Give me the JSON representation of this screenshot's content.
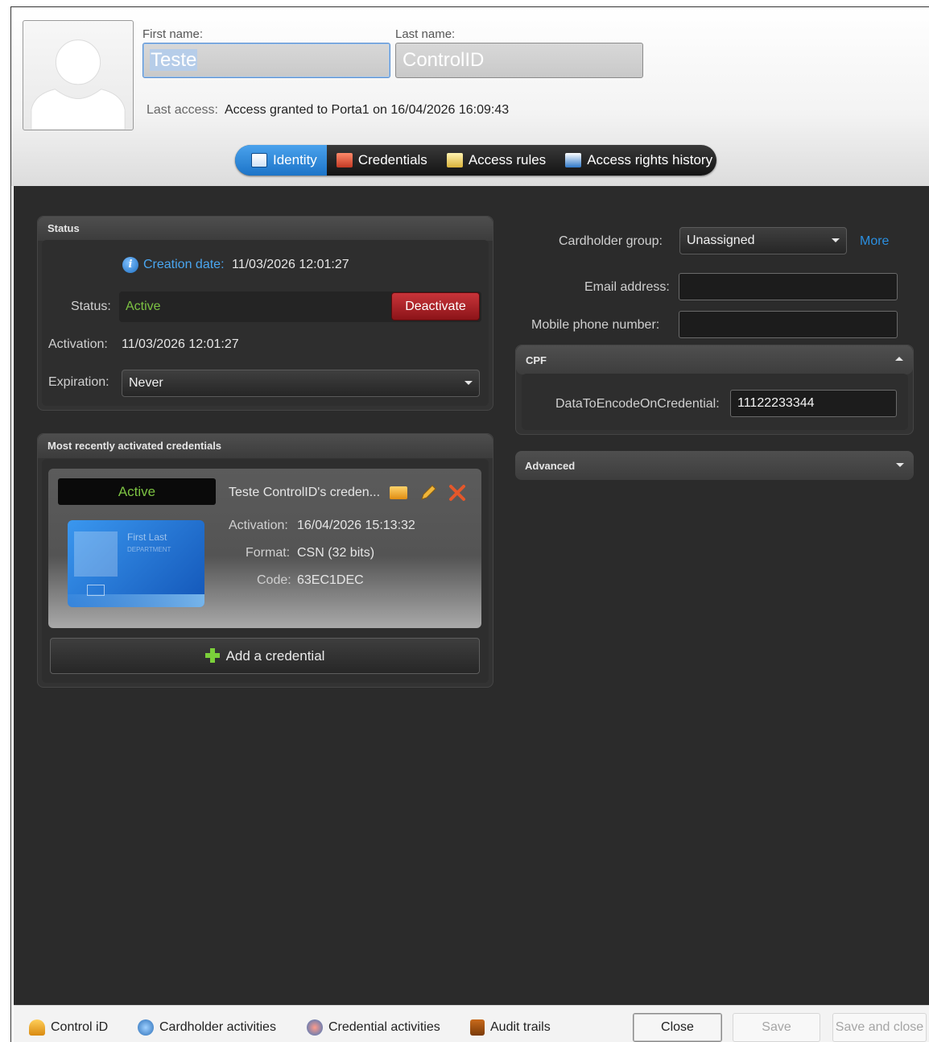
{
  "header": {
    "first_name_label": "First name:",
    "first_name_value": "Teste",
    "last_name_label": "Last name:",
    "last_name_value": "ControlID",
    "last_access_label": "Last access:",
    "last_access_value": "Access granted to Porta1 on 16/04/2026 16:09:43"
  },
  "tabs": [
    {
      "label": "Identity",
      "active": true,
      "icon": "identity-icon"
    },
    {
      "label": "Credentials",
      "active": false,
      "icon": "credentials-icon"
    },
    {
      "label": "Access rules",
      "active": false,
      "icon": "access-rules-icon"
    },
    {
      "label": "Access rights history",
      "active": false,
      "icon": "access-history-icon"
    }
  ],
  "status_panel": {
    "title": "Status",
    "creation_date_label": "Creation date:",
    "creation_date_value": "11/03/2026 12:01:27",
    "status_label": "Status:",
    "status_value": "Active",
    "deactivate_label": "Deactivate",
    "activation_label": "Activation:",
    "activation_value": "11/03/2026 12:01:27",
    "expiration_label": "Expiration:",
    "expiration_value": "Never"
  },
  "credentials_panel": {
    "title": "Most recently activated credentials",
    "card": {
      "state": "Active",
      "name": "Teste ControlID's creden...",
      "card_first_last": "First Last",
      "card_department": "DEPARTMENT",
      "activation_label": "Activation:",
      "activation_value": "16/04/2026 15:13:32",
      "format_label": "Format:",
      "format_value": "CSN (32 bits)",
      "code_label": "Code:",
      "code_value": "63EC1DEC"
    },
    "add_label": "Add a credential"
  },
  "right": {
    "group_label": "Cardholder group:",
    "group_value": "Unassigned",
    "more_label": "More",
    "email_label": "Email address:",
    "email_value": "",
    "mobile_label": "Mobile phone number:",
    "mobile_value": "",
    "cpf_title": "CPF",
    "cpf_field_label": "DataToEncodeOnCredential:",
    "cpf_field_value": "11122233344",
    "advanced_title": "Advanced"
  },
  "footer": {
    "links": [
      {
        "label": "Control iD",
        "icon": "control-id-icon"
      },
      {
        "label": "Cardholder activities",
        "icon": "cardholder-activities-icon"
      },
      {
        "label": "Credential activities",
        "icon": "credential-activities-icon"
      },
      {
        "label": "Audit trails",
        "icon": "audit-trails-icon"
      }
    ],
    "close_label": "Close",
    "save_label": "Save",
    "save_close_label": "Save and close"
  },
  "colors": {
    "accent": "#1e78d2",
    "active_green": "#7cc242",
    "deactivate_red": "#b02a2f",
    "link_blue": "#2b8fe0"
  }
}
